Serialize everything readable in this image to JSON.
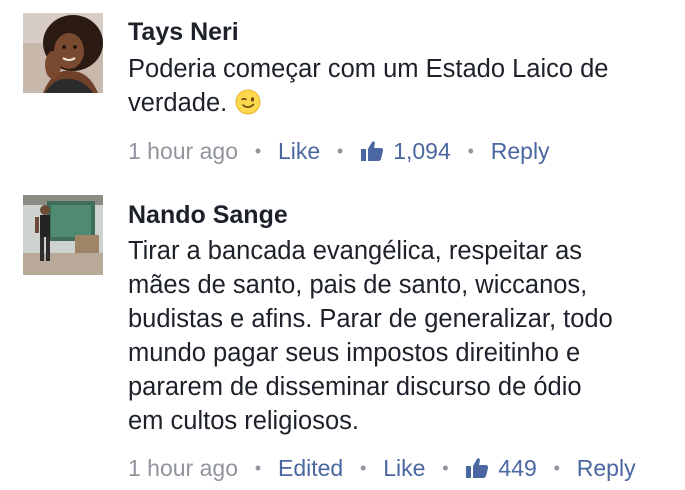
{
  "comments": [
    {
      "author": "Tays Neri",
      "lines": [
        "Poderia começar com um Estado Laico de",
        "verdade."
      ],
      "emoji": "wink-emoji",
      "time": "1 hour ago",
      "like_label": "Like",
      "like_count": "1,094",
      "reply_label": "Reply"
    },
    {
      "author": "Nando Sange",
      "lines": [
        "Tirar a bancada evangélica, respeitar as",
        "mães de santo, pais de santo, wiccanos,",
        "budistas e afins. Parar de generalizar, todo",
        "mundo pagar seus impostos direitinho e",
        "pararem de disseminar discurso de ódio",
        "em cultos religiosos."
      ],
      "time": "1 hour ago",
      "edited_label": "Edited",
      "like_label": "Like",
      "like_count": "449",
      "reply_label": "Reply"
    }
  ],
  "separator": "•",
  "colors": {
    "text": "#1d2129",
    "muted": "#90949c",
    "link": "#4b67a1"
  }
}
